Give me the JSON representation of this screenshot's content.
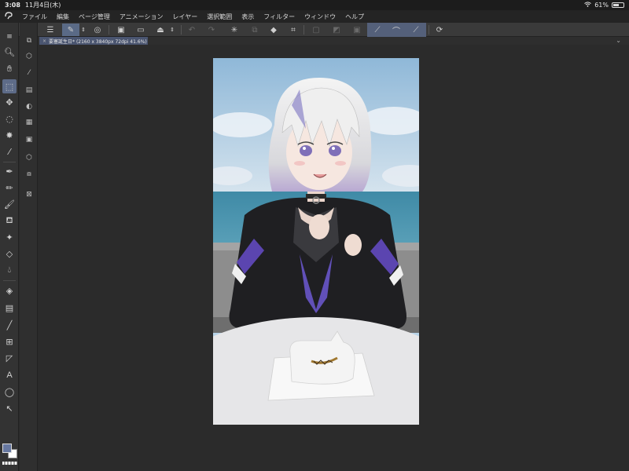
{
  "status_bar": {
    "time": "3:08",
    "date": "11月4日(木)",
    "battery_percent": "61%",
    "battery_level": 0.61
  },
  "menu": {
    "items": [
      "ファイル",
      "編集",
      "ページ管理",
      "アニメーション",
      "レイヤー",
      "選択範囲",
      "表示",
      "フィルター",
      "ウィンドウ",
      "ヘルプ"
    ]
  },
  "document": {
    "tab_label": "要塞誕生日* (2160 x 3840px 72dpi 41.6%)"
  },
  "tool_icons": [
    "zoom-icon",
    "hand-icon",
    "object-select-icon",
    "move-icon",
    "marquee-icon",
    "magic-wand-icon",
    "eyedropper-icon",
    "pen-icon",
    "pencil-icon",
    "brush-icon",
    "airbrush-icon",
    "decoration-icon",
    "eraser-icon",
    "blend-icon",
    "fill-icon",
    "gradient-icon",
    "line-icon",
    "frame-icon",
    "ruler-icon",
    "text-icon",
    "balloon-icon",
    "correction-icon"
  ],
  "colors": {
    "main_color": "#6677a0",
    "sub_color": "#ffffff",
    "accent": "#5d6b88"
  }
}
